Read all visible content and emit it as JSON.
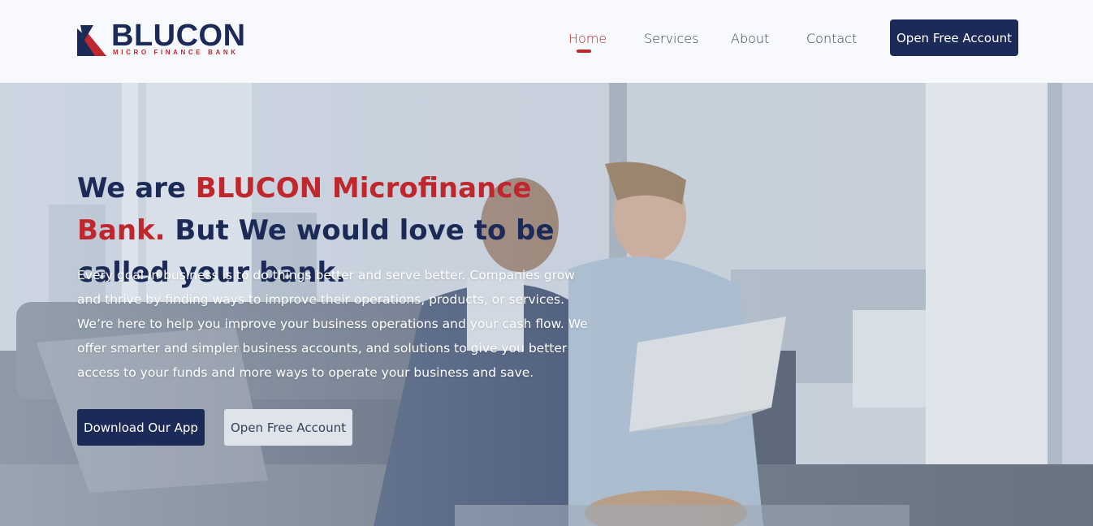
{
  "brand": {
    "name": "BLUCON",
    "tagline": "MICRO FINANCE BANK",
    "colors": {
      "navy": "#1b2a57",
      "red": "#c0272d"
    }
  },
  "nav": {
    "items": [
      {
        "label": "Home",
        "active": true
      },
      {
        "label": "Services",
        "active": false
      },
      {
        "label": "About",
        "active": false
      },
      {
        "label": "Contact",
        "active": false
      }
    ],
    "cta_label": "Open Free Account"
  },
  "hero": {
    "title_part1": "We are ",
    "title_accent": "BLUCON Microfinance Bank.",
    "title_part2": " But We would love to be called your bank.",
    "body": "Every goal in business is to do things better and serve better. Companies grow and thrive by finding ways to improve their operations, products, or services. We’re here to help you improve your business operations and your cash flow. We offer smarter and simpler business accounts, and solutions to give you better access to your funds and more ways to operate your business and save.",
    "primary_button": "Download Our App",
    "secondary_button": "Open Free Account"
  }
}
